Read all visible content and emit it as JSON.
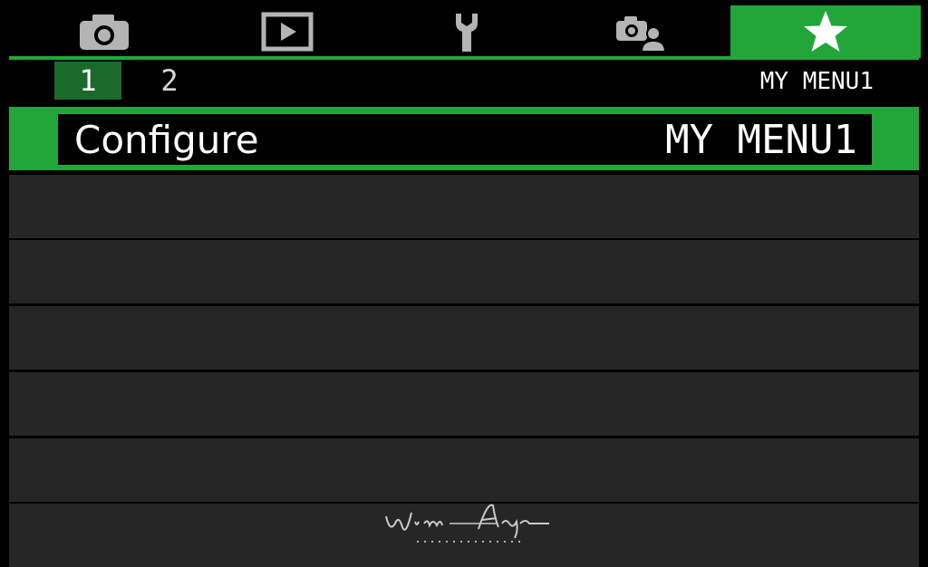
{
  "tabs": [
    {
      "name": "camera",
      "icon": "camera-icon",
      "active": false
    },
    {
      "name": "playback",
      "icon": "playback-icon",
      "active": false
    },
    {
      "name": "setup",
      "icon": "wrench-icon",
      "active": false
    },
    {
      "name": "custom-functions",
      "icon": "camera-person-icon",
      "active": false
    },
    {
      "name": "my-menu",
      "icon": "star-icon",
      "active": true
    }
  ],
  "pages": [
    {
      "label": "1",
      "active": true
    },
    {
      "label": "2",
      "active": false
    }
  ],
  "current_menu_title": "MY MENU1",
  "rows": [
    {
      "label": "Configure",
      "value": "MY MENU1",
      "selected": true
    }
  ],
  "colors": {
    "accent": "#22a63a",
    "page_active": "#1c6a2b",
    "row_bg": "#262626",
    "background": "#000000",
    "icon_gray": "#b4b4b4"
  },
  "watermark": "Wim Arys Photography"
}
